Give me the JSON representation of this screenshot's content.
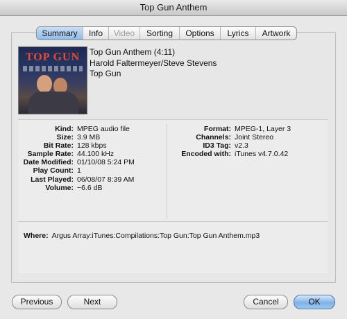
{
  "window": {
    "title": "Top Gun Anthem"
  },
  "tabs": [
    {
      "label": "Summary",
      "state": "active"
    },
    {
      "label": "Info",
      "state": "normal"
    },
    {
      "label": "Video",
      "state": "disabled"
    },
    {
      "label": "Sorting",
      "state": "normal"
    },
    {
      "label": "Options",
      "state": "normal"
    },
    {
      "label": "Lyrics",
      "state": "normal"
    },
    {
      "label": "Artwork",
      "state": "normal"
    }
  ],
  "album_art": {
    "logo_text": "TOP GUN"
  },
  "track": {
    "title_line": "Top Gun Anthem (4:11)",
    "artist": "Harold Faltermeyer/Steve Stevens",
    "album": "Top Gun"
  },
  "info_left": [
    {
      "label": "Kind:",
      "value": "MPEG audio file"
    },
    {
      "label": "Size:",
      "value": "3.9 MB"
    },
    {
      "label": "Bit Rate:",
      "value": "128 kbps"
    },
    {
      "label": "Sample Rate:",
      "value": "44.100 kHz"
    },
    {
      "label": "Date Modified:",
      "value": "01/10/08 5:24 PM"
    },
    {
      "label": "Play Count:",
      "value": "1"
    },
    {
      "label": "Last Played:",
      "value": "06/08/07 8:39 AM"
    },
    {
      "label": "Volume:",
      "value": "−6.6 dB"
    }
  ],
  "info_right": [
    {
      "label": "Format:",
      "value": "MPEG-1, Layer 3"
    },
    {
      "label": "Channels:",
      "value": "Joint Stereo"
    },
    {
      "label": "ID3 Tag:",
      "value": "v2.3"
    },
    {
      "label": "Encoded with:",
      "value": "iTunes v4.7.0.42"
    }
  ],
  "where": {
    "label": "Where:",
    "value": "Argus Array:iTunes:Compilations:Top Gun:Top Gun Anthem.mp3"
  },
  "buttons": {
    "previous": "Previous",
    "next": "Next",
    "cancel": "Cancel",
    "ok": "OK"
  },
  "colors": {
    "active_tab": "#9cc3ee",
    "ok_button": "#8bbcea",
    "background": "#e8e8e8"
  }
}
